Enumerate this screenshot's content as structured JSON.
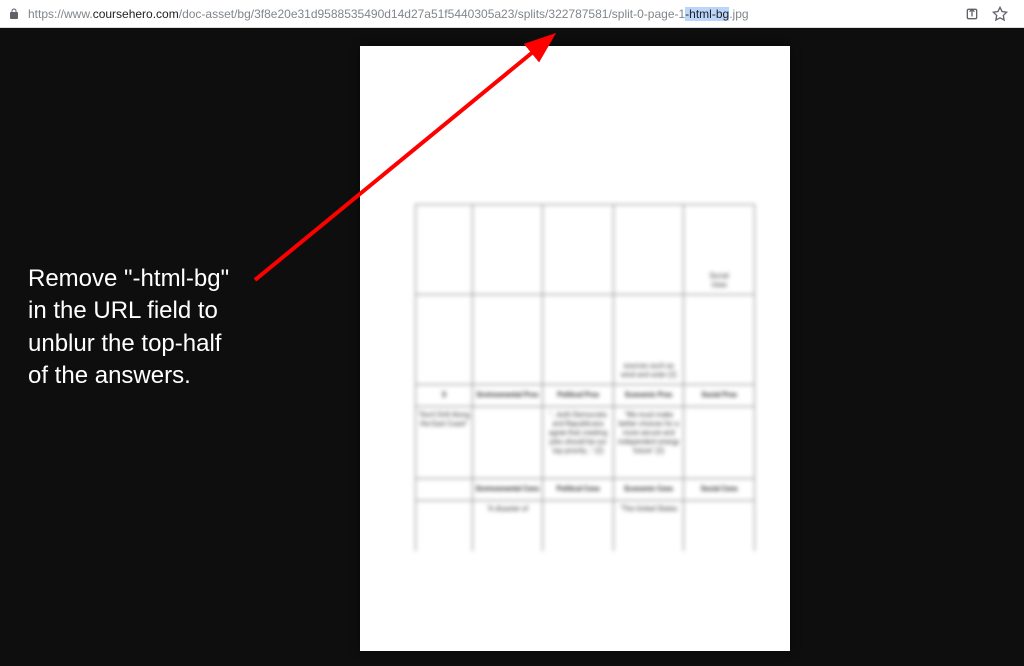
{
  "address_bar": {
    "url_prefix": "https://www.",
    "url_domain": "coursehero.com",
    "url_path": "/doc-asset/bg/3f8e20e31d9588535490d14d27a51f5440305a23/splits/322787581/split-0-page-1",
    "url_highlighted": "-html-bg",
    "url_suffix": ".jpg"
  },
  "instruction": {
    "line1": "Remove \"-html-bg\"",
    "line2": "in the URL field to",
    "line3": "unblur the top-half",
    "line4": "of the answers."
  },
  "document": {
    "cell_r1c5_a": "Social",
    "cell_r1c5_b": "Uses",
    "cell_r2c4": "sources such as wind and solar (2)",
    "hdr_c2": "Environmental Pros",
    "hdr_c3": "Political Pros",
    "hdr_c4": "Economic Pros",
    "hdr_c5": "Social Pros",
    "cell_r3c1": "\"Don't Drill Along the East Coast\"",
    "cell_r3c3": "\"...both Democrats and Republicans agree that creating jobs should be our top priority...\" (2)",
    "cell_r3c4": "\"We must make better choices for a more secure and independent energy future\" (2)",
    "hdr2_c2": "Environmental Cons",
    "hdr2_c3": "Political Cons",
    "hdr2_c4": "Economic Cons",
    "hdr2_c5": "Social Cons",
    "cell_r4c2": "\"A disaster of",
    "cell_r4c4": "\"The United States"
  }
}
